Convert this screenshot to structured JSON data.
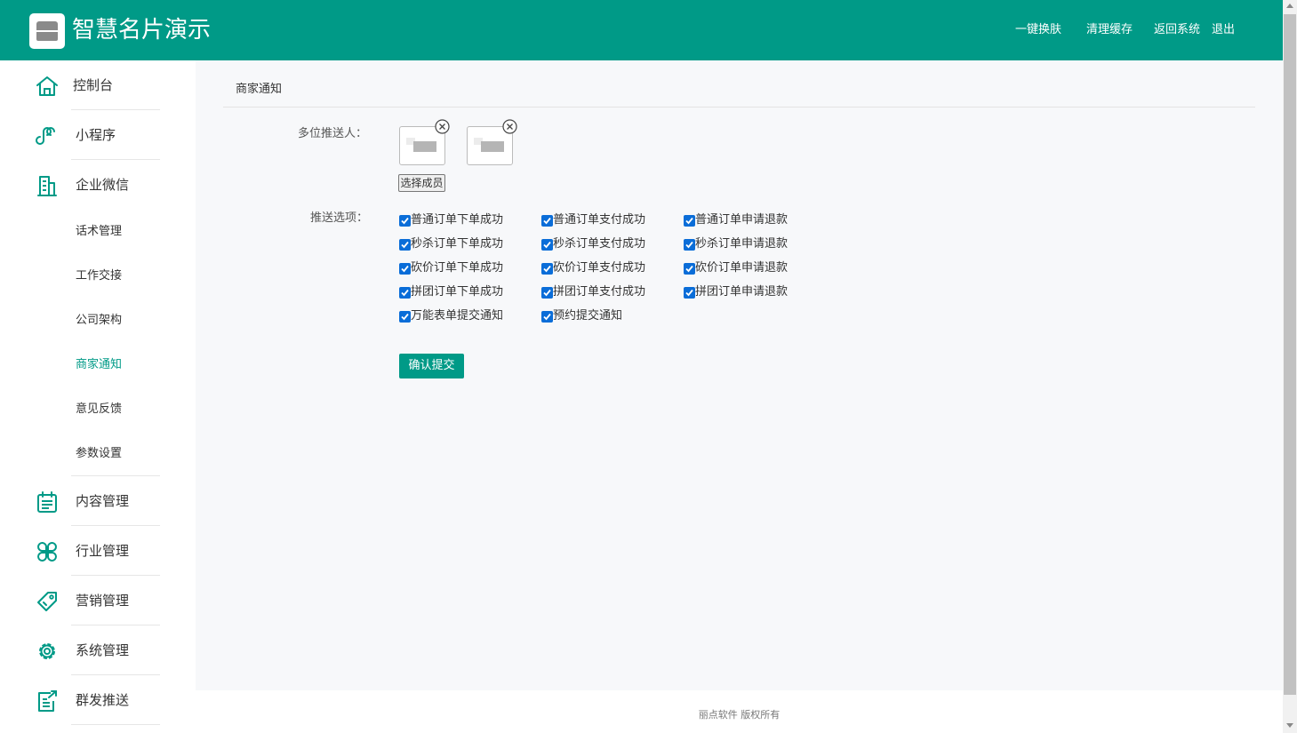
{
  "header": {
    "title": "智慧名片演示",
    "logo_icon": "store-icon",
    "actions": [
      "一键换肤",
      "清理缓存",
      "返回系统",
      "退出"
    ],
    "background_color": "#009a87"
  },
  "sidebar": {
    "items": [
      {
        "label": "控制台",
        "icon": "home-icon"
      },
      {
        "label": "小程序",
        "icon": "mini-program-icon"
      },
      {
        "label": "企业微信",
        "icon": "building-icon"
      },
      {
        "label": "内容管理",
        "icon": "calendar-list-icon"
      },
      {
        "label": "行业管理",
        "icon": "grid-clover-icon"
      },
      {
        "label": "营销管理",
        "icon": "tag-icon"
      },
      {
        "label": "系统管理",
        "icon": "gear-icon"
      },
      {
        "label": "群发推送",
        "icon": "broadcast-export-icon"
      }
    ],
    "submenu": [
      "话术管理",
      "工作交接",
      "公司架构",
      "商家通知",
      "意见反馈",
      "参数设置"
    ],
    "active_sub": "商家通知",
    "accent_color": "#009a87"
  },
  "panel": {
    "title": "商家通知",
    "push_label": "多位推送人：",
    "select_button": "选择成员",
    "options_label": "推送选项：",
    "options": [
      [
        "普通订单下单成功",
        "普通订单支付成功",
        "普通订单申请退款"
      ],
      [
        "秒杀订单下单成功",
        "秒杀订单支付成功",
        "秒杀订单申请退款"
      ],
      [
        "砍价订单下单成功",
        "砍价订单支付成功",
        "砍价订单申请退款"
      ],
      [
        "拼团订单下单成功",
        "拼团订单支付成功",
        "拼团订单申请退款"
      ],
      [
        "万能表单提交通知",
        "预约提交通知"
      ]
    ],
    "submit_button": "确认提交"
  },
  "footer": {
    "text": "丽点软件 版权所有"
  }
}
